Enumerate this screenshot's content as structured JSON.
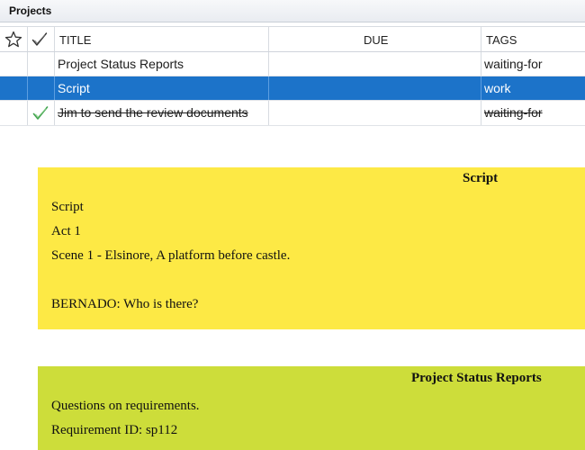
{
  "panel": {
    "title": "Projects"
  },
  "grid": {
    "columns": {
      "star_icon": "star-outline-icon",
      "check_icon": "checkmark-icon",
      "title": "TITLE",
      "due": "DUE",
      "tags": "TAGS"
    },
    "rows": [
      {
        "title": "Project Status Reports",
        "due": "",
        "tags": "waiting-for",
        "completed": false,
        "selected": false
      },
      {
        "title": "Script",
        "due": "",
        "tags": "work",
        "completed": false,
        "selected": true
      },
      {
        "title": "Jim to send the review documents",
        "due": "",
        "tags": "waiting-for",
        "completed": true,
        "selected": false
      }
    ]
  },
  "colors": {
    "selection": "#1c73c9",
    "card_yellow": "#fde945",
    "card_green": "#cddd3a",
    "check_green": "#3fa34d"
  },
  "notes": [
    {
      "title": "Script",
      "lines": [
        "Script",
        "Act 1",
        "Scene 1 - Elsinore, A platform before castle.",
        "",
        "BERNADO: Who is there?"
      ]
    },
    {
      "title": "Project Status Reports",
      "lines": [
        "Questions on requirements.",
        "Requirement ID: sp112"
      ]
    }
  ]
}
